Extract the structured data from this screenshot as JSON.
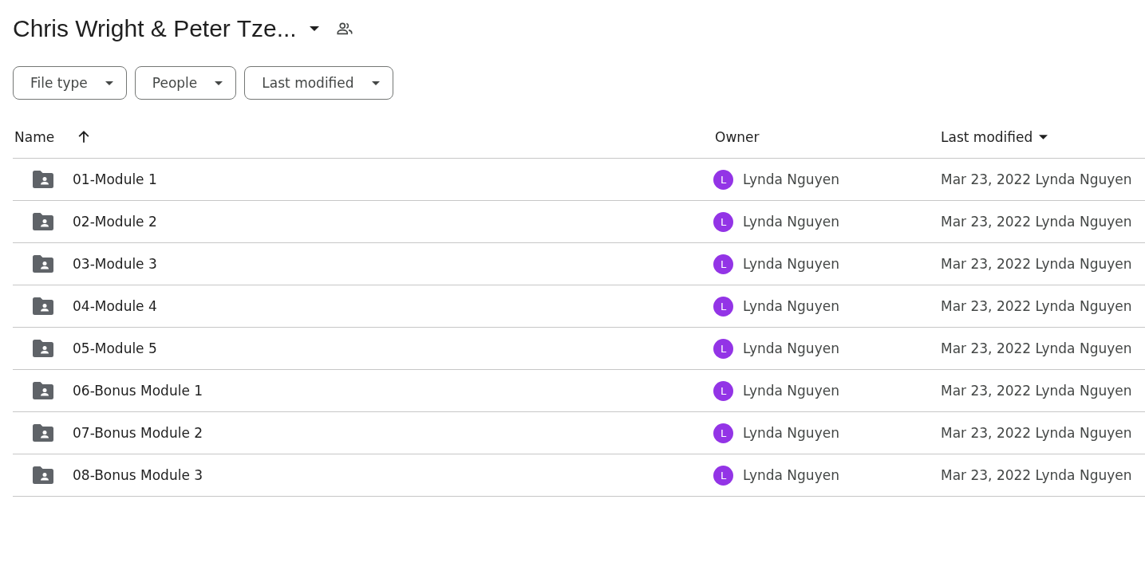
{
  "folder": {
    "title": "Chris Wright & Peter Tze..."
  },
  "filters": [
    {
      "label": "File type"
    },
    {
      "label": "People"
    },
    {
      "label": "Last modified"
    }
  ],
  "table": {
    "columns": [
      {
        "label": "Name",
        "kind": "name"
      },
      {
        "label": "Owner",
        "kind": "owner"
      },
      {
        "label": "Last modified",
        "kind": "modified"
      }
    ],
    "rows": [
      {
        "name": "01-Module 1",
        "owner_initial": "L",
        "owner": "Lynda Nguyen",
        "modified": "Mar 23, 2022 Lynda Nguyen"
      },
      {
        "name": "02-Module 2",
        "owner_initial": "L",
        "owner": "Lynda Nguyen",
        "modified": "Mar 23, 2022 Lynda Nguyen"
      },
      {
        "name": "03-Module 3",
        "owner_initial": "L",
        "owner": "Lynda Nguyen",
        "modified": "Mar 23, 2022 Lynda Nguyen"
      },
      {
        "name": "04-Module 4",
        "owner_initial": "L",
        "owner": "Lynda Nguyen",
        "modified": "Mar 23, 2022 Lynda Nguyen"
      },
      {
        "name": "05-Module 5",
        "owner_initial": "L",
        "owner": "Lynda Nguyen",
        "modified": "Mar 23, 2022 Lynda Nguyen"
      },
      {
        "name": "06-Bonus Module 1",
        "owner_initial": "L",
        "owner": "Lynda Nguyen",
        "modified": "Mar 23, 2022 Lynda Nguyen"
      },
      {
        "name": "07-Bonus Module 2",
        "owner_initial": "L",
        "owner": "Lynda Nguyen",
        "modified": "Mar 23, 2022 Lynda Nguyen"
      },
      {
        "name": "08-Bonus Module 3",
        "owner_initial": "L",
        "owner": "Lynda Nguyen",
        "modified": "Mar 23, 2022 Lynda Nguyen"
      }
    ]
  }
}
